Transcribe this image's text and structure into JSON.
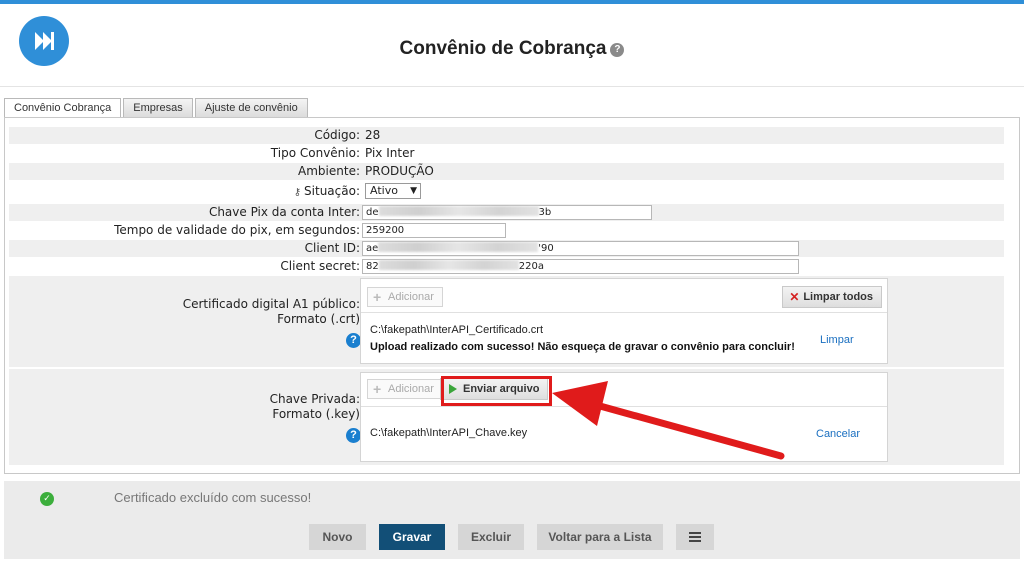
{
  "header": {
    "title": "Convênio de Cobrança",
    "help_glyph": "?"
  },
  "tabs": [
    {
      "label": "Convênio Cobrança",
      "active": true
    },
    {
      "label": "Empresas",
      "active": false
    },
    {
      "label": "Ajuste de convênio",
      "active": false
    }
  ],
  "form": {
    "codigo": {
      "label": "Código:",
      "value": "28"
    },
    "tipo": {
      "label": "Tipo Convênio:",
      "value": "Pix Inter"
    },
    "ambiente": {
      "label": "Ambiente:",
      "value": "PRODUÇÃO"
    },
    "situacao": {
      "label": "Situação:",
      "value": "Ativo"
    },
    "chave_pix": {
      "label": "Chave Pix da conta Inter:",
      "prefix": "de",
      "suffix": "3b"
    },
    "tempo_validade": {
      "label": "Tempo de validade do pix, em segundos:",
      "value": "259200"
    },
    "client_id": {
      "label": "Client ID:",
      "prefix": "ae",
      "suffix": "'90"
    },
    "client_secret": {
      "label": "Client secret:",
      "prefix": "82",
      "suffix": "220a"
    }
  },
  "certificado": {
    "label_line1": "Certificado digital A1 público:",
    "label_line2": "Formato (.crt)",
    "add_label": "Adicionar",
    "clear_all_label": "Limpar todos",
    "file_path": "C:\\fakepath\\InterAPI_Certificado.crt",
    "message": "Upload realizado com sucesso! Não esqueça de gravar o convênio para concluir!",
    "clear_label": "Limpar"
  },
  "chave_privada": {
    "label_line1": "Chave Privada:",
    "label_line2": "Formato (.key)",
    "add_label": "Adicionar",
    "send_label": "Enviar arquivo",
    "file_path": "C:\\fakepath\\InterAPI_Chave.key",
    "cancel_label": "Cancelar"
  },
  "footer": {
    "status_message": "Certificado excluído com sucesso!",
    "buttons": {
      "novo": "Novo",
      "gravar": "Gravar",
      "excluir": "Excluir",
      "voltar": "Voltar para a Lista"
    }
  },
  "colors": {
    "accent": "#2f8fd8",
    "primary_button": "#124f77",
    "annotation": "#e01b1b",
    "success": "#3cae3c"
  }
}
